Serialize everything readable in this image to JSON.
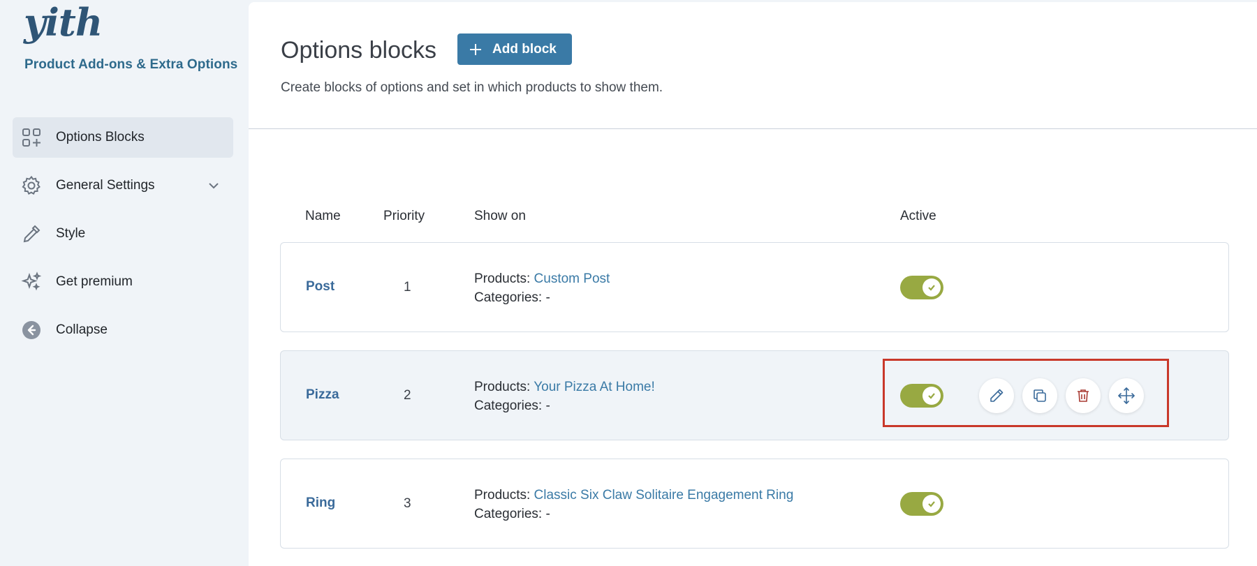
{
  "app": {
    "logo_text": "yith",
    "brand": "Product Add-ons & Extra Options"
  },
  "sidebar": {
    "items": [
      {
        "label": "Options Blocks",
        "icon": "grid-plus-icon",
        "active": true
      },
      {
        "label": "General Settings",
        "icon": "gear-icon",
        "has_submenu": true
      },
      {
        "label": "Style",
        "icon": "eyedropper-icon"
      },
      {
        "label": "Get premium",
        "icon": "sparkles-icon"
      },
      {
        "label": "Collapse",
        "icon": "arrow-left-circle-icon"
      }
    ]
  },
  "header": {
    "title": "Options blocks",
    "add_button": "Add block",
    "subtitle": "Create blocks of options and set in which products to show them."
  },
  "table": {
    "columns": [
      "Name",
      "Priority",
      "Show on",
      "Active"
    ],
    "rows": [
      {
        "name": "Post",
        "priority": "1",
        "products_label": "Products:",
        "products": "Custom Post",
        "categories_label": "Categories:",
        "categories": "-",
        "active": true
      },
      {
        "name": "Pizza",
        "priority": "2",
        "products_label": "Products:",
        "products": "Your Pizza At Home!",
        "categories_label": "Categories:",
        "categories": "-",
        "active": true
      },
      {
        "name": "Ring",
        "priority": "3",
        "products_label": "Products:",
        "products": "Classic Six Claw Solitaire Engagement Ring",
        "categories_label": "Categories:",
        "categories": "-",
        "active": true
      }
    ]
  },
  "colors": {
    "accent": "#3a7aa6",
    "toggle_on": "#98a942",
    "highlight": "#c9382a",
    "delete": "#a83a32"
  }
}
